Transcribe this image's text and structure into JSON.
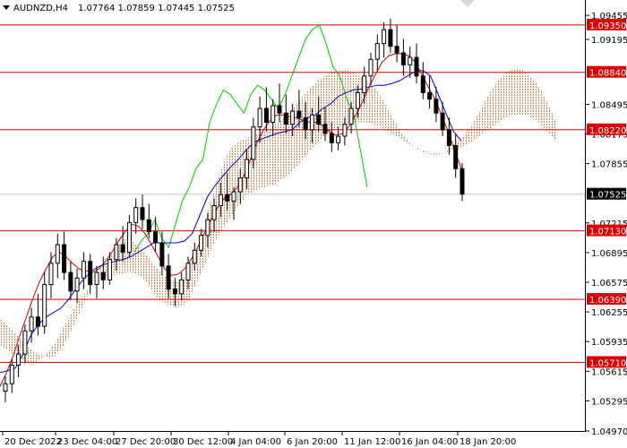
{
  "header": {
    "symbol": "AUDNZD,H4",
    "ohlc": "1.07764 1.07859 1.07445 1.07525"
  },
  "chart_data": {
    "type": "candlestick",
    "ylim": [
      1.0497,
      1.0962
    ],
    "y_ticks": [
      "1.09455",
      "1.09195",
      "1.08495",
      "1.08175",
      "1.07855",
      "1.07215",
      "1.06895",
      "1.06575",
      "1.06255",
      "1.05935",
      "1.05615",
      "1.05295",
      "1.04970"
    ],
    "x_ticks": [
      "20 Dec 2022",
      "23 Dec 04:00",
      "27 Dec 20:00",
      "30 Dec 12:00",
      "4 Jan 04:00",
      "6 Jan 20:00",
      "11 Jan 12:00",
      "16 Jan 04:00",
      "18 Jan 20:00"
    ],
    "levels": [
      {
        "label": "1.09350",
        "value": 1.0935
      },
      {
        "label": "1.08840",
        "value": 1.0884
      },
      {
        "label": "1.08220",
        "value": 1.0822
      },
      {
        "label": "1.07130",
        "value": 1.0713
      },
      {
        "label": "1.06390",
        "value": 1.0639
      },
      {
        "label": "1.05710",
        "value": 1.0571
      }
    ],
    "current_price": {
      "label": "1.07525",
      "value": 1.07525
    },
    "candles": [
      [
        1.054,
        1.0556,
        1.0528,
        1.0548
      ],
      [
        1.0548,
        1.0575,
        1.0538,
        1.0568
      ],
      [
        1.0568,
        1.059,
        1.0555,
        1.058
      ],
      [
        1.058,
        1.0612,
        1.057,
        1.0605
      ],
      [
        1.0605,
        1.063,
        1.0592,
        1.062
      ],
      [
        1.062,
        1.0645,
        1.06,
        1.061
      ],
      [
        1.061,
        1.0668,
        1.0602,
        1.0655
      ],
      [
        1.0655,
        1.069,
        1.064,
        1.0678
      ],
      [
        1.0678,
        1.071,
        1.0662,
        1.0698
      ],
      [
        1.0698,
        1.0712,
        1.066,
        1.0668
      ],
      [
        1.0668,
        1.068,
        1.0638,
        1.0648
      ],
      [
        1.0648,
        1.0672,
        1.0635,
        1.0662
      ],
      [
        1.0662,
        1.069,
        1.065,
        1.068
      ],
      [
        1.068,
        1.0688,
        1.0645,
        1.0655
      ],
      [
        1.0655,
        1.0675,
        1.064,
        1.0668
      ],
      [
        1.0668,
        1.0685,
        1.065,
        1.066
      ],
      [
        1.066,
        1.069,
        1.0655,
        1.0682
      ],
      [
        1.0682,
        1.0705,
        1.067,
        1.0698
      ],
      [
        1.0698,
        1.0718,
        1.068,
        1.069
      ],
      [
        1.069,
        1.073,
        1.0685,
        1.0722
      ],
      [
        1.0722,
        1.0748,
        1.071,
        1.0738
      ],
      [
        1.0738,
        1.0752,
        1.0715,
        1.0725
      ],
      [
        1.0725,
        1.0742,
        1.0705,
        1.0712
      ],
      [
        1.0712,
        1.0728,
        1.069,
        1.07
      ],
      [
        1.07,
        1.0712,
        1.0665,
        1.0675
      ],
      [
        1.0675,
        1.0688,
        1.064,
        1.065
      ],
      [
        1.065,
        1.0662,
        1.0632,
        1.0645
      ],
      [
        1.0645,
        1.0668,
        1.0638,
        1.066
      ],
      [
        1.066,
        1.0685,
        1.065,
        1.0678
      ],
      [
        1.0678,
        1.07,
        1.067,
        1.0692
      ],
      [
        1.0692,
        1.0715,
        1.0685,
        1.0708
      ],
      [
        1.0708,
        1.0732,
        1.0695,
        1.0725
      ],
      [
        1.0725,
        1.0748,
        1.0712,
        1.074
      ],
      [
        1.074,
        1.0765,
        1.0728,
        1.0752
      ],
      [
        1.0752,
        1.0775,
        1.0735,
        1.0745
      ],
      [
        1.0745,
        1.076,
        1.0725,
        1.0755
      ],
      [
        1.0755,
        1.078,
        1.0742,
        1.077
      ],
      [
        1.077,
        1.08,
        1.0758,
        1.079
      ],
      [
        1.079,
        1.0835,
        1.078,
        1.0825
      ],
      [
        1.0825,
        1.0858,
        1.0808,
        1.0845
      ],
      [
        1.0845,
        1.0868,
        1.082,
        1.083
      ],
      [
        1.083,
        1.0855,
        1.0815,
        1.0848
      ],
      [
        1.0848,
        1.0872,
        1.083,
        1.084
      ],
      [
        1.084,
        1.086,
        1.0818,
        1.0828
      ],
      [
        1.0828,
        1.085,
        1.0815,
        1.0842
      ],
      [
        1.0842,
        1.0865,
        1.0825,
        1.0835
      ],
      [
        1.0835,
        1.0852,
        1.0812,
        1.0822
      ],
      [
        1.0822,
        1.0845,
        1.0808,
        1.0838
      ],
      [
        1.0838,
        1.0858,
        1.082,
        1.0828
      ],
      [
        1.0828,
        1.0846,
        1.081,
        1.0818
      ],
      [
        1.0818,
        1.083,
        1.0798,
        1.0808
      ],
      [
        1.0808,
        1.0825,
        1.08,
        1.0815
      ],
      [
        1.0815,
        1.0835,
        1.0805,
        1.0828
      ],
      [
        1.0828,
        1.0852,
        1.0818,
        1.0845
      ],
      [
        1.0845,
        1.087,
        1.0835,
        1.0862
      ],
      [
        1.0862,
        1.089,
        1.085,
        1.088
      ],
      [
        1.088,
        1.0905,
        1.087,
        1.0898
      ],
      [
        1.0898,
        1.0925,
        1.0885,
        1.0915
      ],
      [
        1.0915,
        1.0938,
        1.09,
        1.093
      ],
      [
        1.093,
        1.0942,
        1.0905,
        1.0912
      ],
      [
        1.0912,
        1.0935,
        1.0895,
        1.0905
      ],
      [
        1.0905,
        1.092,
        1.088,
        1.0892
      ],
      [
        1.0892,
        1.0912,
        1.0878,
        1.09
      ],
      [
        1.09,
        1.0915,
        1.0872,
        1.088
      ],
      [
        1.088,
        1.0895,
        1.0855,
        1.0862
      ],
      [
        1.0862,
        1.088,
        1.0845,
        1.0855
      ],
      [
        1.0855,
        1.0868,
        1.083,
        1.084
      ],
      [
        1.084,
        1.0852,
        1.0815,
        1.0822
      ],
      [
        1.0822,
        1.0835,
        1.0795,
        1.0805
      ],
      [
        1.0805,
        1.0818,
        1.077,
        1.078
      ],
      [
        1.078,
        1.0786,
        1.0745,
        1.07525
      ]
    ],
    "series": [
      {
        "color": "#00cc00",
        "values": [
          1.069,
          1.0702,
          1.071,
          1.0725,
          1.0705,
          1.0695,
          1.072,
          1.0745,
          1.076,
          1.078,
          1.079,
          1.083,
          1.085,
          1.0865,
          1.086,
          1.085,
          1.084,
          1.086,
          1.087,
          1.0865,
          1.0855,
          1.0845,
          1.086,
          1.088,
          1.09,
          1.092,
          1.093,
          1.0935,
          1.0915,
          1.089,
          1.088,
          1.0855,
          1.084,
          1.08,
          1.076
        ]
      },
      {
        "color": "#cc0000",
        "values": [
          1.0545,
          1.056,
          1.0578,
          1.06,
          1.062,
          1.064,
          1.0658,
          1.0672,
          1.0685,
          1.069,
          1.0685,
          1.0678,
          1.0672,
          1.067,
          1.0668,
          1.0672,
          1.068,
          1.069,
          1.0702,
          1.0712,
          1.072,
          1.0718,
          1.071,
          1.0698,
          1.0685,
          1.0672,
          1.0665,
          1.0666,
          1.0672,
          1.0682,
          1.0695,
          1.071,
          1.0725,
          1.0738,
          1.0748,
          1.0752,
          1.076,
          1.0772,
          1.079,
          1.0808,
          1.0822,
          1.0832,
          1.0838,
          1.0838,
          1.0836,
          1.0835,
          1.0832,
          1.083,
          1.083,
          1.0826,
          1.082,
          1.0816,
          1.0818,
          1.0826,
          1.0838,
          1.0852,
          1.0868,
          1.0882,
          1.0895,
          1.0902,
          1.0904,
          1.0904,
          1.0902,
          1.0895,
          1.0882,
          1.0868,
          1.0855,
          1.0838,
          1.082,
          1.08,
          1.078
        ]
      },
      {
        "color": "#0000cc",
        "values": [
          1.056,
          1.0562,
          1.0565,
          1.058,
          1.06,
          1.0612,
          1.062,
          1.0625,
          1.063,
          1.064,
          1.0652,
          1.0662,
          1.067,
          1.0675,
          1.0678,
          1.068,
          1.0682,
          1.0685,
          1.069,
          1.0695,
          1.07,
          1.07,
          1.07,
          1.07,
          1.0702,
          1.071,
          1.073,
          1.075,
          1.0762,
          1.0772,
          1.0782,
          1.079,
          1.08,
          1.0808,
          1.0812,
          1.0815,
          1.0818,
          1.082,
          1.0822,
          1.083,
          1.0835,
          1.0838,
          1.0845,
          1.085,
          1.0858,
          1.0862,
          1.0865,
          1.0866,
          1.0868,
          1.087,
          1.087,
          1.0872,
          1.0875,
          1.088,
          1.0885,
          1.0886,
          1.088,
          1.086,
          1.084,
          1.082,
          1.081
        ]
      },
      {
        "color": "#e0804a",
        "values": [
          1.062,
          1.0612,
          1.0605,
          1.0598,
          1.059,
          1.0585,
          1.058,
          1.0578,
          1.0575,
          1.058,
          1.0588,
          1.06,
          1.0615,
          1.063,
          1.0645,
          1.066,
          1.0672,
          1.068,
          1.069,
          1.07,
          1.0705,
          1.0702,
          1.0695,
          1.0688,
          1.068,
          1.0672,
          1.0665,
          1.066,
          1.0658,
          1.0662,
          1.0672,
          1.069,
          1.0712,
          1.0735,
          1.0758,
          1.0778,
          1.0795,
          1.0805,
          1.081,
          1.0812,
          1.0815,
          1.0818,
          1.082,
          1.0825,
          1.083,
          1.0835,
          1.0842,
          1.085,
          1.0858,
          1.0865,
          1.0872,
          1.0878,
          1.0882,
          1.0885,
          1.0886,
          1.0886,
          1.0884,
          1.088,
          1.0875,
          1.087,
          1.0862,
          1.085,
          1.0838,
          1.0826,
          1.0815,
          1.0808,
          1.0802,
          1.0798,
          1.0796,
          1.0795,
          1.0796,
          1.08,
          1.0806,
          1.0812,
          1.082,
          1.083,
          1.0842,
          1.0855,
          1.0866,
          1.0875,
          1.0882,
          1.0887,
          1.0888,
          1.0886,
          1.088,
          1.0872,
          1.0862,
          1.0848,
          1.0832
        ]
      },
      {
        "color": "#e0804a",
        "values": [
          1.059,
          1.0585,
          1.058,
          1.0575,
          1.0572,
          1.057,
          1.0572,
          1.0578,
          1.0585,
          1.0595,
          1.0608,
          1.062,
          1.0632,
          1.0642,
          1.065,
          1.0656,
          1.066,
          1.0663,
          1.0665,
          1.0666,
          1.0668,
          1.0668,
          1.0665,
          1.066,
          1.065,
          1.064,
          1.0635,
          1.0632,
          1.063,
          1.0632,
          1.064,
          1.0655,
          1.067,
          1.0685,
          1.07,
          1.0712,
          1.0722,
          1.0732,
          1.0742,
          1.075,
          1.0755,
          1.0758,
          1.076,
          1.0762,
          1.0765,
          1.077,
          1.0776,
          1.0782,
          1.079,
          1.0798,
          1.0806,
          1.0812,
          1.0818,
          1.0822,
          1.0825,
          1.0828,
          1.083,
          1.083,
          1.083,
          1.0828,
          1.0826,
          1.0822,
          1.0818,
          1.0814,
          1.081,
          1.0806,
          1.0803,
          1.08,
          1.0798,
          1.0797,
          1.0797,
          1.0798,
          1.08,
          1.0803,
          1.0806,
          1.081,
          1.0815,
          1.082,
          1.0825,
          1.083,
          1.0834,
          1.0837,
          1.0838,
          1.0838,
          1.0836,
          1.0832,
          1.0826,
          1.0818,
          1.081
        ]
      }
    ]
  }
}
